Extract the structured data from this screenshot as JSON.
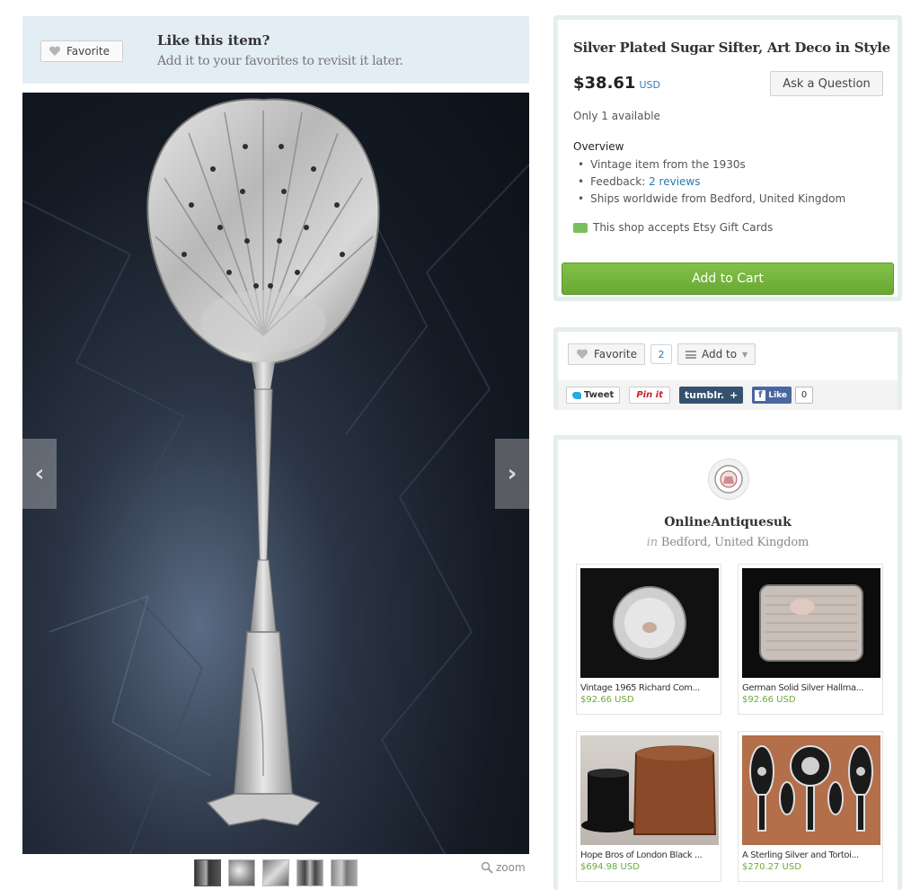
{
  "favorite_banner": {
    "button_label": "Favorite",
    "title": "Like this item?",
    "subtitle": "Add it to your favorites to revisit it later."
  },
  "gallery": {
    "prev_icon": "chevron-left-icon",
    "next_icon": "chevron-right-icon",
    "thumbnail_count": 5,
    "zoom_label": "zoom"
  },
  "listing": {
    "title": "Silver Plated Sugar Sifter, Art Deco in Style",
    "price": "$38.61",
    "currency": "USD",
    "ask_button": "Ask a Question",
    "availability": "Only 1 available",
    "overview_heading": "Overview",
    "overview": {
      "item1": "Vintage item from the 1930s",
      "feedback_prefix": "Feedback: ",
      "feedback_link": "2 reviews",
      "item3": "Ships worldwide from Bedford, United Kingdom"
    },
    "giftcard_text": "This shop accepts Etsy Gift Cards",
    "add_to_cart": "Add to Cart",
    "accent_color": "#75b53d",
    "link_color": "#2a7ab0"
  },
  "social": {
    "favorite_label": "Favorite",
    "favorite_count": "2",
    "add_to_label": "Add to",
    "tweet": "Tweet",
    "pin": "Pin it",
    "tumblr": "tumblr.",
    "tumblr_plus": "+",
    "fb_like": "Like",
    "fb_count": "0"
  },
  "shop": {
    "name": "OnlineAntiquesuk",
    "location_prefix": "in",
    "location": "Bedford, United Kingdom",
    "items": [
      {
        "title": "Vintage 1965 Richard Com...",
        "price": "$92.66 USD"
      },
      {
        "title": "German Solid Silver Hallma...",
        "price": "$92.66 USD"
      },
      {
        "title": "Hope Bros of London Black ...",
        "price": "$694.98 USD"
      },
      {
        "title": "A Sterling Silver and Tortoi...",
        "price": "$270.27 USD"
      }
    ]
  }
}
